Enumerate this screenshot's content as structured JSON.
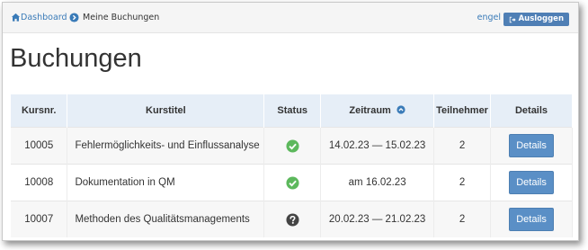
{
  "breadcrumb": {
    "home_label": "Dashboard",
    "current_label": "Meine Buchungen"
  },
  "header": {
    "user_label": "engel",
    "logout_label": "Ausloggen"
  },
  "page": {
    "title": "Buchungen"
  },
  "table": {
    "columns": {
      "kursnr": "Kursnr.",
      "kurstitel": "Kurstitel",
      "status": "Status",
      "zeitraum": "Zeitraum",
      "teilnehmer": "Teilnehmer",
      "details": "Details"
    },
    "rows": [
      {
        "kursnr": "10005",
        "kurstitel": "Fehlermöglichkeits- und Einflussanalyse",
        "status": "confirmed",
        "zeitraum": "14.02.23 — 15.02.23",
        "teilnehmer": "2",
        "details": "Details"
      },
      {
        "kursnr": "10008",
        "kurstitel": "Dokumentation in QM",
        "status": "confirmed",
        "zeitraum": "am 16.02.23",
        "teilnehmer": "2",
        "details": "Details"
      },
      {
        "kursnr": "10007",
        "kurstitel": "Methoden des Qualitätsmanagements",
        "status": "unknown",
        "zeitraum": "20.02.23 — 21.02.23",
        "teilnehmer": "2",
        "details": "Details"
      }
    ]
  },
  "colors": {
    "link": "#3a7bb8",
    "button": "#5a8fc6",
    "status_ok": "#5cb85c",
    "status_unknown": "#444444",
    "header_bg": "#e6eef7"
  },
  "icons": {
    "home": "home-icon",
    "breadcrumb_separator": "chevron-right-circle-icon",
    "logout": "sign-out-icon",
    "sort": "chevron-up-circle-icon",
    "status_ok": "check-circle-icon",
    "status_unknown": "question-circle-icon"
  }
}
